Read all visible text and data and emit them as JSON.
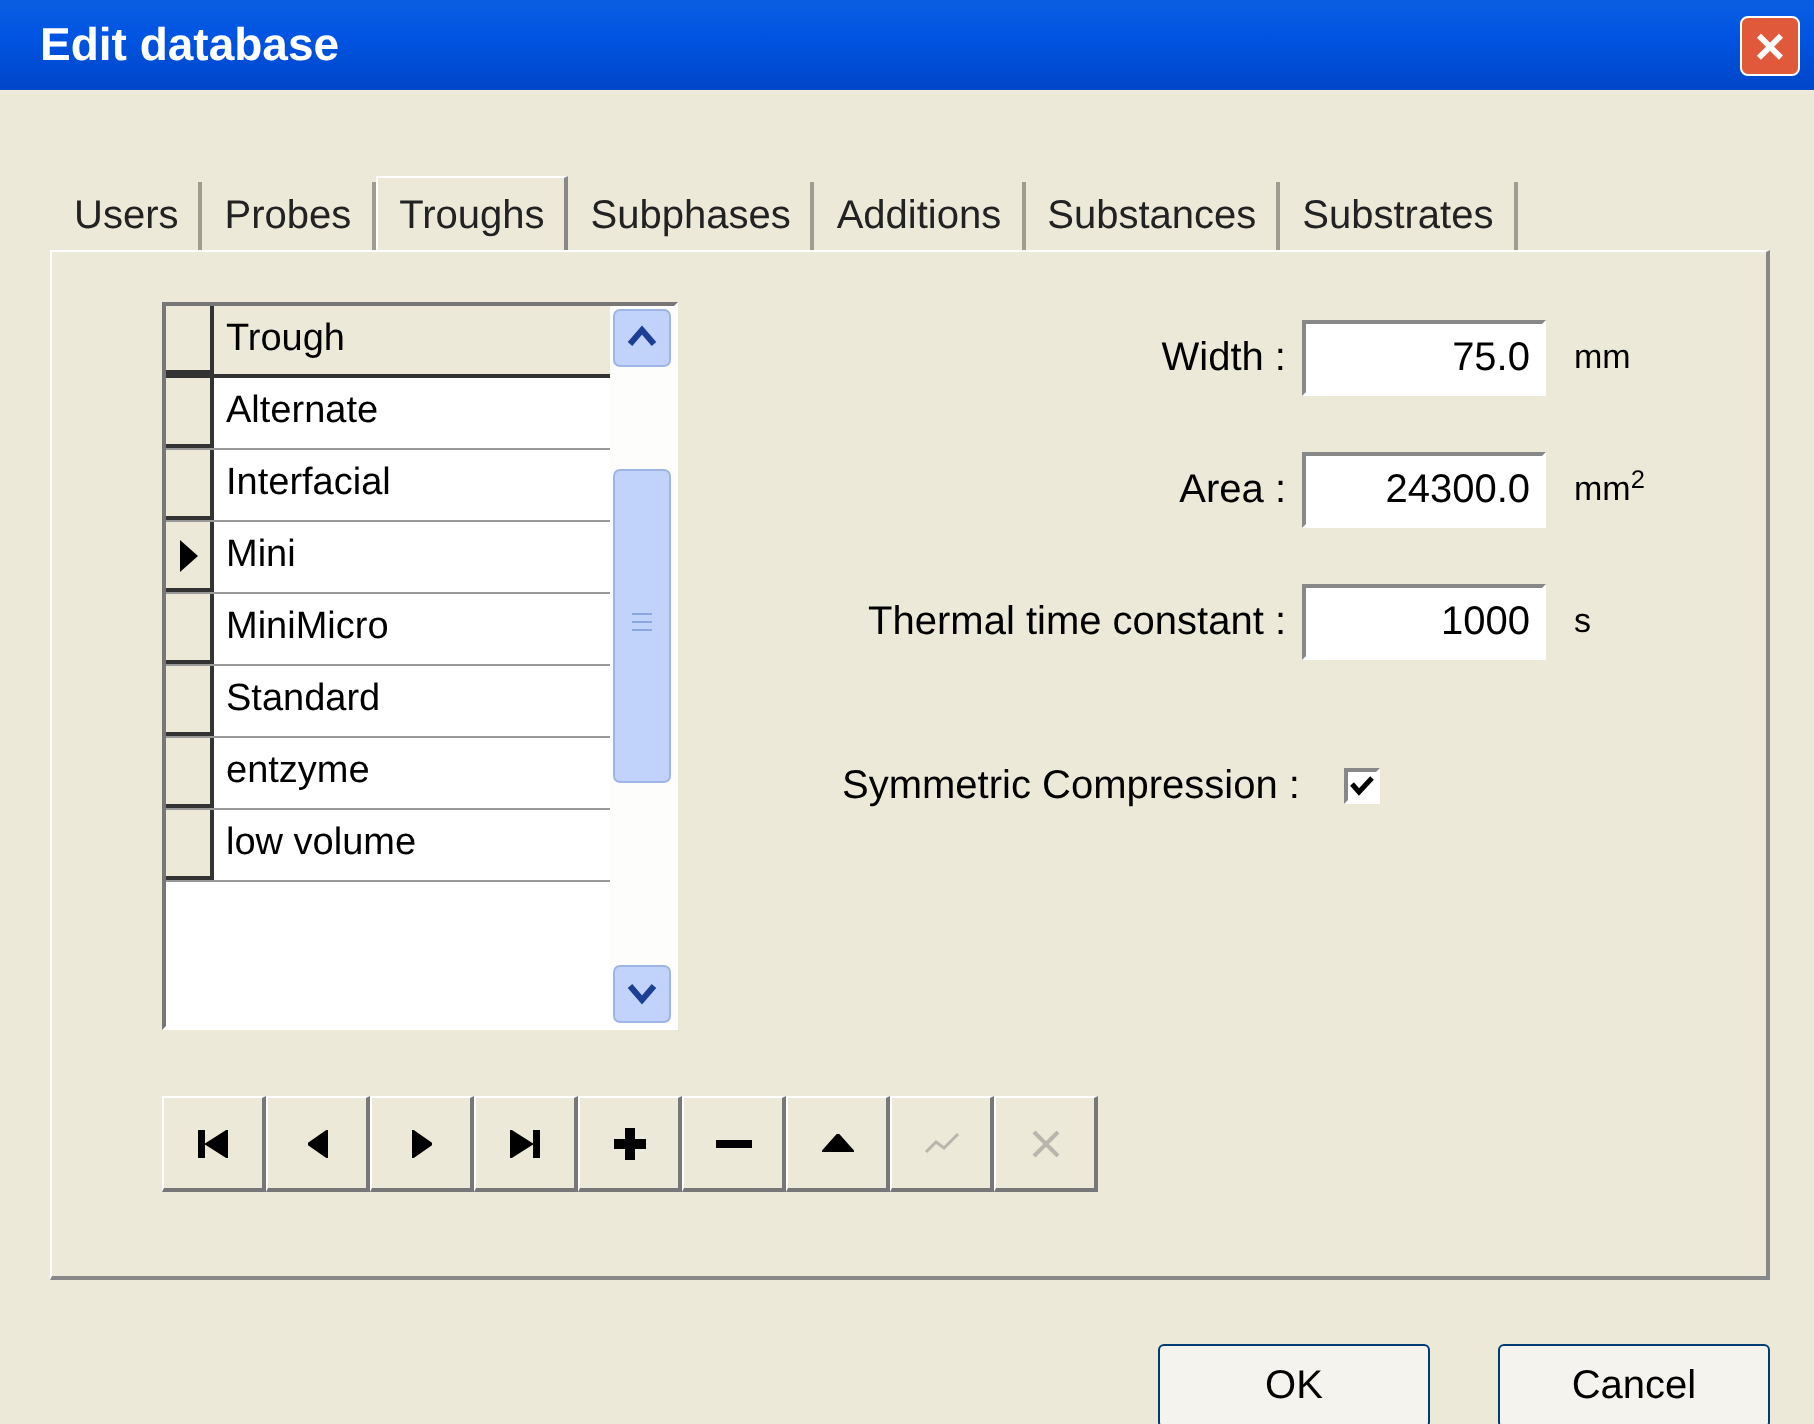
{
  "window": {
    "title": "Edit database",
    "close": "×"
  },
  "tabs": [
    {
      "label": "Users",
      "selected": false
    },
    {
      "label": "Probes",
      "selected": false
    },
    {
      "label": "Troughs",
      "selected": true
    },
    {
      "label": "Subphases",
      "selected": false
    },
    {
      "label": "Additions",
      "selected": false
    },
    {
      "label": "Substances",
      "selected": false
    },
    {
      "label": "Substrates",
      "selected": false
    }
  ],
  "grid": {
    "column": "Trough",
    "rows": [
      {
        "name": "Alternate",
        "selected": false
      },
      {
        "name": "Interfacial",
        "selected": false
      },
      {
        "name": "Mini",
        "selected": true
      },
      {
        "name": "MiniMicro",
        "selected": false
      },
      {
        "name": "Standard",
        "selected": false
      },
      {
        "name": "entzyme",
        "selected": false
      },
      {
        "name": "low volume",
        "selected": false
      }
    ]
  },
  "navigator": [
    {
      "kind": "first",
      "disabled": false
    },
    {
      "kind": "prior",
      "disabled": false
    },
    {
      "kind": "next",
      "disabled": false
    },
    {
      "kind": "last",
      "disabled": false
    },
    {
      "kind": "insert",
      "disabled": false
    },
    {
      "kind": "delete",
      "disabled": false
    },
    {
      "kind": "edit",
      "disabled": false
    },
    {
      "kind": "post",
      "disabled": true
    },
    {
      "kind": "cancel",
      "disabled": true
    }
  ],
  "fields": [
    {
      "label": "Width :",
      "value": "75.0",
      "unit": "mm"
    },
    {
      "label": "Area :",
      "value": "24300.0",
      "unit": "mm$^{2}$"
    },
    {
      "label": "Thermal time constant :",
      "value": "1000",
      "unit": "s"
    }
  ],
  "symmetric_compression": {
    "label": "Symmetric Compression :",
    "checked": true
  },
  "buttons": [
    {
      "label": "OK"
    },
    {
      "label": "Cancel"
    }
  ]
}
